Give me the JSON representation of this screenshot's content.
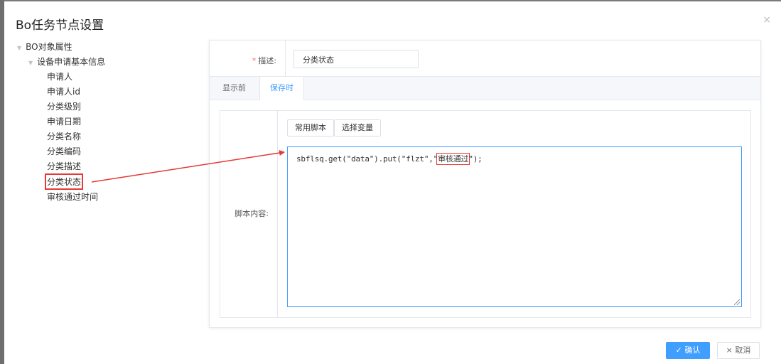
{
  "dialog": {
    "title": "Bo任务节点设置",
    "close_glyph": "×"
  },
  "tree": {
    "root": {
      "label": "BO对象属性",
      "icon": "caret-down-icon"
    },
    "group": {
      "label": "设备申请基本信息",
      "icon": "caret-down-icon"
    },
    "leaves": [
      "申请人",
      "申请人id",
      "分类级别",
      "申请日期",
      "分类名称",
      "分类编码",
      "分类描述",
      "分类状态",
      "审核通过时间"
    ],
    "selected_leaf": "分类状态"
  },
  "form": {
    "required_mark": "*",
    "desc_label": "描述:",
    "desc_value": "分类状态",
    "tabs": [
      "显示前",
      "保存时"
    ],
    "active_tab": "保存时",
    "script_label": "脚本内容:",
    "buttons": {
      "common_script": "常用脚本",
      "select_var": "选择变量"
    },
    "code_prefix": "sbflsq.get(\"data\").put(\"flzt\",\"",
    "code_highlight": "审核通过",
    "code_suffix": "\");"
  },
  "footer": {
    "ok_label": "✓ 确认",
    "cancel_label": "× 取消"
  },
  "colors": {
    "accent": "#409eff",
    "annotation_red": "#e53935"
  }
}
